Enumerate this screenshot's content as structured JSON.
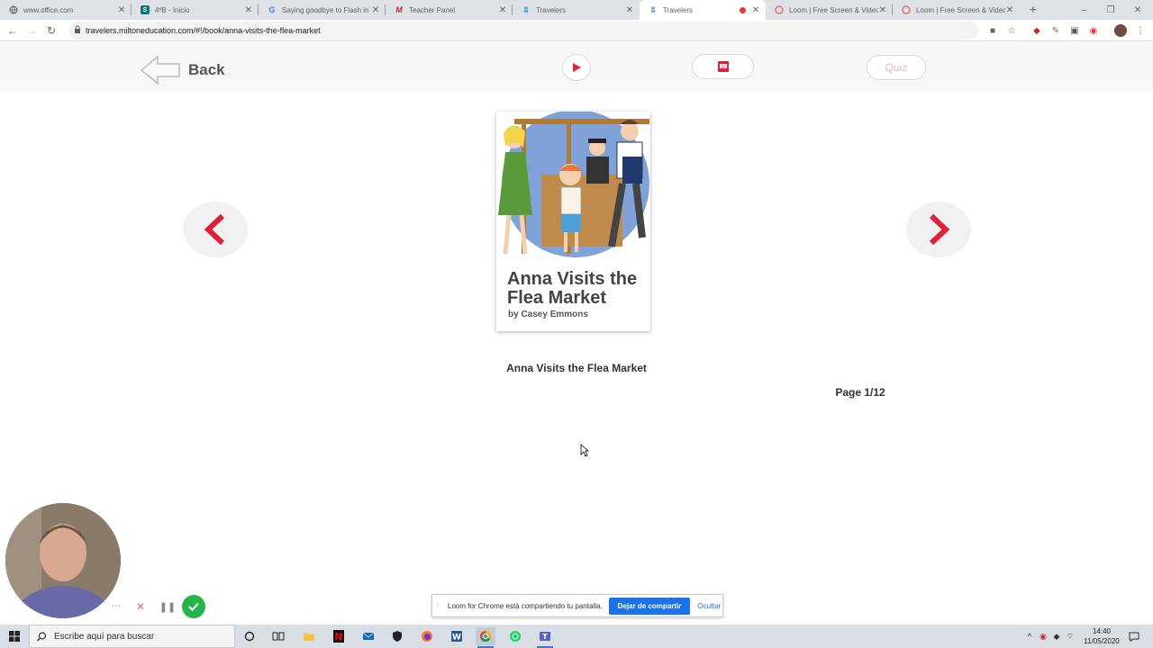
{
  "browser": {
    "tabs": [
      {
        "title": "www.office.com",
        "icon": "globe-icon",
        "active": false
      },
      {
        "title": "4ºB - Inicio",
        "icon": "sharepoint-icon",
        "active": false
      },
      {
        "title": "Saying goodbye to Flash in",
        "icon": "google-icon",
        "active": false
      },
      {
        "title": "Teacher Panel",
        "icon": "milton-icon",
        "active": false
      },
      {
        "title": "Travelers",
        "icon": "travelers-icon",
        "active": false
      },
      {
        "title": "Travelers",
        "icon": "travelers-icon",
        "active": true,
        "recording": true
      },
      {
        "title": "Loom | Free Screen & Video",
        "icon": "loom-icon",
        "active": false
      },
      {
        "title": "Loom | Free Screen & Video",
        "icon": "loom-icon",
        "active": false
      }
    ],
    "url": "travelers.miltoneducation.com/#!/book/anna-visits-the-flea-market"
  },
  "app": {
    "back_label": "Back",
    "quiz_label": "Quiz",
    "accent_color": "#e0203a"
  },
  "book": {
    "cover_title": "Anna Visits the Flea Market",
    "cover_author": "by Casey Emmons",
    "title": "Anna Visits the Flea Market",
    "page_indicator": "Page 1/12",
    "current_page": 1,
    "total_pages": 12
  },
  "loom": {
    "share_message": "Loom for Chrome está compartiendo tu pantalla.",
    "stop_sharing_label": "Dejar de compartir",
    "hide_label": "Ocultar"
  },
  "taskbar": {
    "search_placeholder": "Escribe aquí para buscar",
    "time": "14:40",
    "date": "11/05/2020"
  }
}
